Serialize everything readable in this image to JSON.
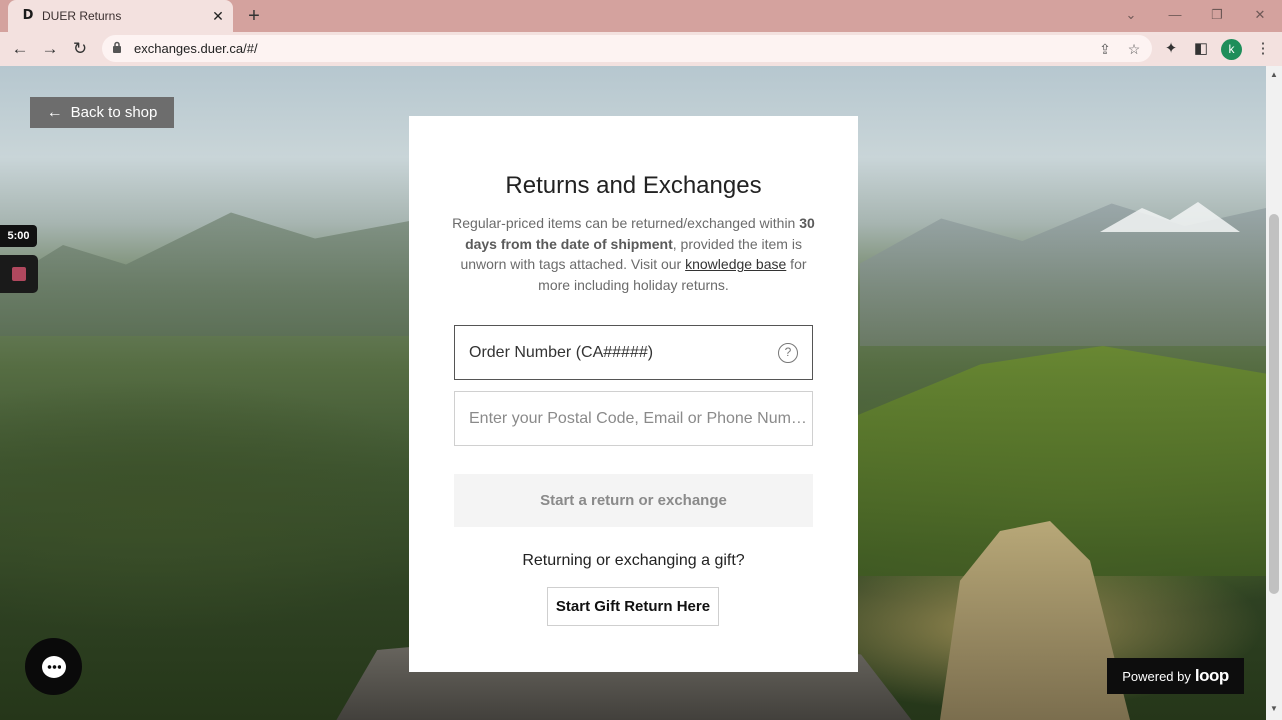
{
  "browser": {
    "tab_title": "DUER Returns",
    "tab_favicon": "D",
    "url": "exchanges.duer.ca/#/",
    "profile_initial": "k"
  },
  "page": {
    "back_label": "Back to shop",
    "timer": "5:00",
    "card": {
      "title": "Returns and Exchanges",
      "desc_part1": "Regular-priced items can be returned/exchanged within ",
      "desc_bold": "30 days from the date of shipment",
      "desc_part2": ", provided the item is unworn with tags attached. Visit our ",
      "desc_link": "knowledge base",
      "desc_part3": " for more including holiday returns.",
      "order_label": "Order Number (CA#####)",
      "postal_placeholder": "Enter your Postal Code, Email or Phone Num…",
      "start_button": "Start a return or exchange",
      "gift_prompt": "Returning or exchanging a gift?",
      "gift_button": "Start Gift Return Here"
    },
    "powered_text": "Powered by",
    "powered_logo": "loop"
  },
  "icons": {
    "back": "←",
    "forward": "→",
    "reload": "↻",
    "lock": "🔒",
    "help": "?"
  }
}
